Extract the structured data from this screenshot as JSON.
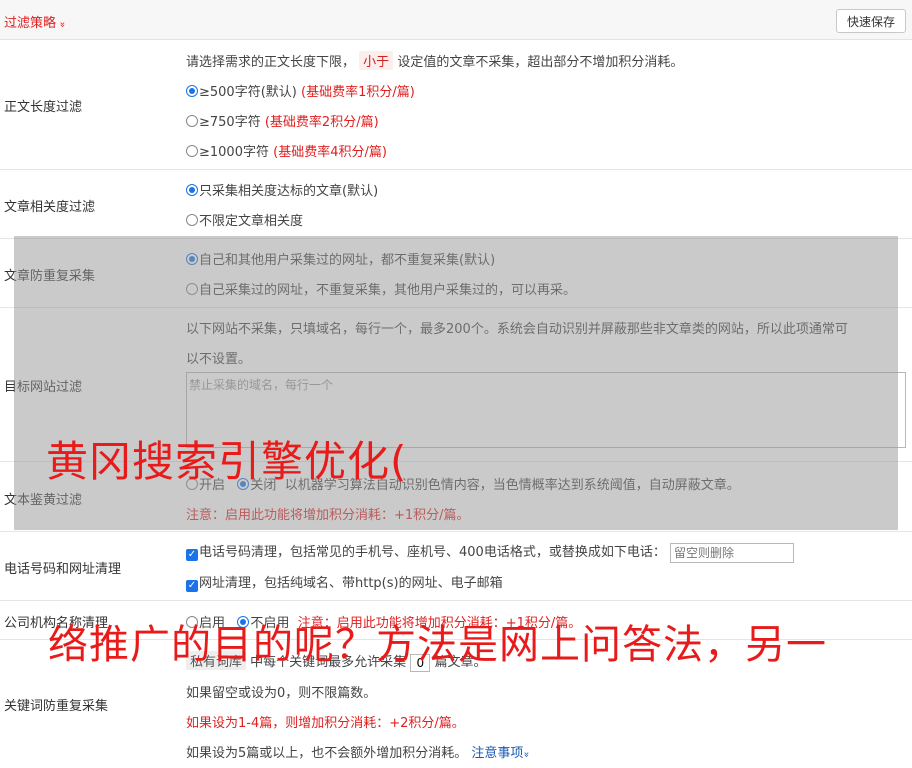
{
  "header": {
    "title": "过滤策略",
    "chevron": "»",
    "save_label": "快速保存"
  },
  "length_filter": {
    "label": "正文长度过滤",
    "desc_pre": "请选择需求的正文长度下限，",
    "desc_tag": "小于",
    "desc_post": "设定值的文章不采集，超出部分不增加积分消耗。",
    "options": [
      {
        "text": "≥500字符(默认)",
        "fee": "(基础费率1积分/篇)",
        "checked": true
      },
      {
        "text": "≥750字符",
        "fee": "(基础费率2积分/篇)",
        "checked": false
      },
      {
        "text": "≥1000字符",
        "fee": "(基础费率4积分/篇)",
        "checked": false
      }
    ]
  },
  "relevance_filter": {
    "label": "文章相关度过滤",
    "options": [
      {
        "text": "只采集相关度达标的文章(默认)",
        "checked": true
      },
      {
        "text": "不限定文章相关度",
        "checked": false
      }
    ]
  },
  "dedup_filter": {
    "label": "文章防重复采集",
    "options": [
      {
        "text": "自己和其他用户采集过的网址，都不重复采集(默认)",
        "checked": true
      },
      {
        "text": "自己采集过的网址，不重复采集，其他用户采集过的，可以再采。",
        "checked": false
      }
    ]
  },
  "site_filter": {
    "label": "目标网站过滤",
    "desc_line1": "以下网站不采集，只填域名，每行一个，最多200个。系统会自动识别并屏蔽那些非文章类的网站，所以此项通常可",
    "desc_line2": "以不设置。",
    "placeholder": "禁止采集的域名，每行一个"
  },
  "porn_filter": {
    "label": "文本鉴黄过滤",
    "on_label": "开启",
    "off_label": "关闭",
    "desc": "以机器学习算法自动识别色情内容，当色情概率达到系统阈值，自动屏蔽文章。",
    "note": "注意：启用此功能将增加积分消耗：+1积分/篇。"
  },
  "contact_filter": {
    "label": "电话号码和网址清理",
    "phone_text": "电话号码清理，包括常见的手机号、座机号、400电话格式，或替换成如下电话：",
    "phone_placeholder": "留空则删除",
    "url_text": "网址清理，包括纯域名、带http(s)的网址、电子邮箱"
  },
  "company_filter": {
    "label": "公司机构名称清理",
    "on_label": "启用",
    "off_label": "不启用",
    "note": "注意：启用此功能将增加积分消耗：+1积分/篇。"
  },
  "keyword_dedup": {
    "label": "关键词防重复采集",
    "chip": "私有词库",
    "line1_mid": "中每个关键词最多允许采集",
    "value": "0",
    "line1_end": "篇文章。",
    "line2": "如果留空或设为0，则不限篇数。",
    "line3": "如果设为1-4篇，则增加积分消耗：+2积分/篇。",
    "line4": "如果设为5篇或以上，也不会额外增加积分消耗。",
    "notice_link": "注意事项",
    "notice_chev": "»"
  },
  "watermarks": {
    "line1": "黄冈搜索引擎优化(",
    "line2": "络推广的目的呢？方法是网上问答法，另一"
  }
}
